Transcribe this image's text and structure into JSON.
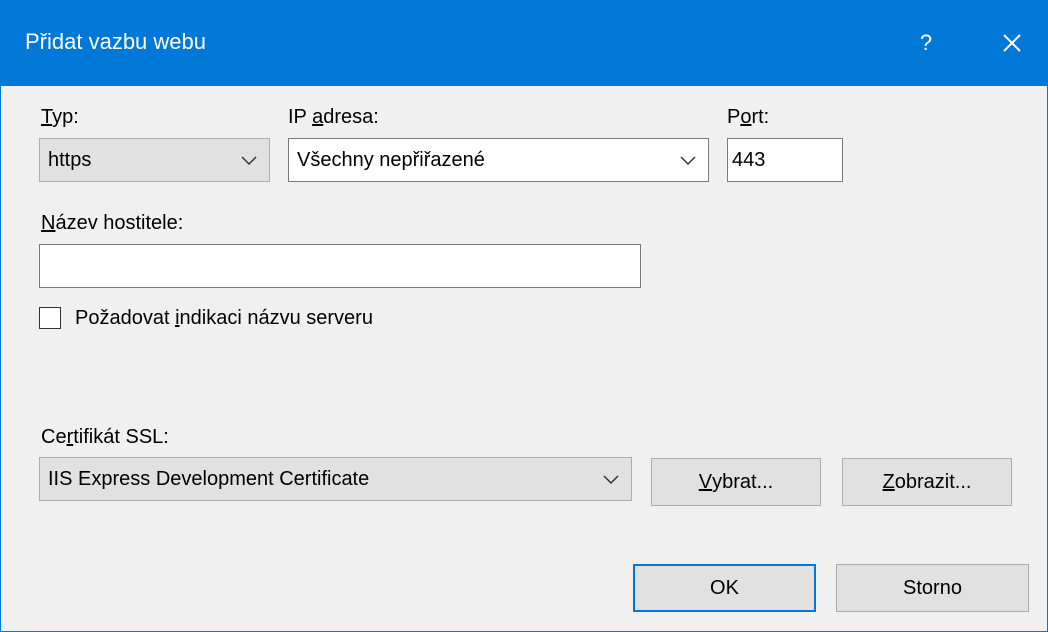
{
  "window": {
    "title": "Přidat vazbu webu",
    "help_label": "?",
    "accent_color": "#0078d7"
  },
  "type_field": {
    "label_accel": "T",
    "label_rest": "yp:",
    "value": "https"
  },
  "ip_field": {
    "label_pre": "IP ",
    "label_accel": "a",
    "label_rest": "dresa:",
    "value": "Všechny nepřiřazené"
  },
  "port_field": {
    "label_pre": "P",
    "label_accel": "o",
    "label_rest": "rt:",
    "value": "443"
  },
  "hostname_field": {
    "label_accel": "N",
    "label_rest": "ázev hostitele:",
    "value": ""
  },
  "sni_checkbox": {
    "label_pre": "Požadovat ",
    "label_accel": "i",
    "label_rest": "ndikaci názvu serveru",
    "checked": false
  },
  "ssl_field": {
    "label_pre": "Ce",
    "label_accel": "r",
    "label_rest": "tifikát SSL:",
    "value": "IIS Express Development Certificate"
  },
  "buttons": {
    "select_accel": "V",
    "select_rest": "ybrat...",
    "view_accel": "Z",
    "view_rest": "obrazit...",
    "ok": "OK",
    "cancel": "Storno"
  }
}
